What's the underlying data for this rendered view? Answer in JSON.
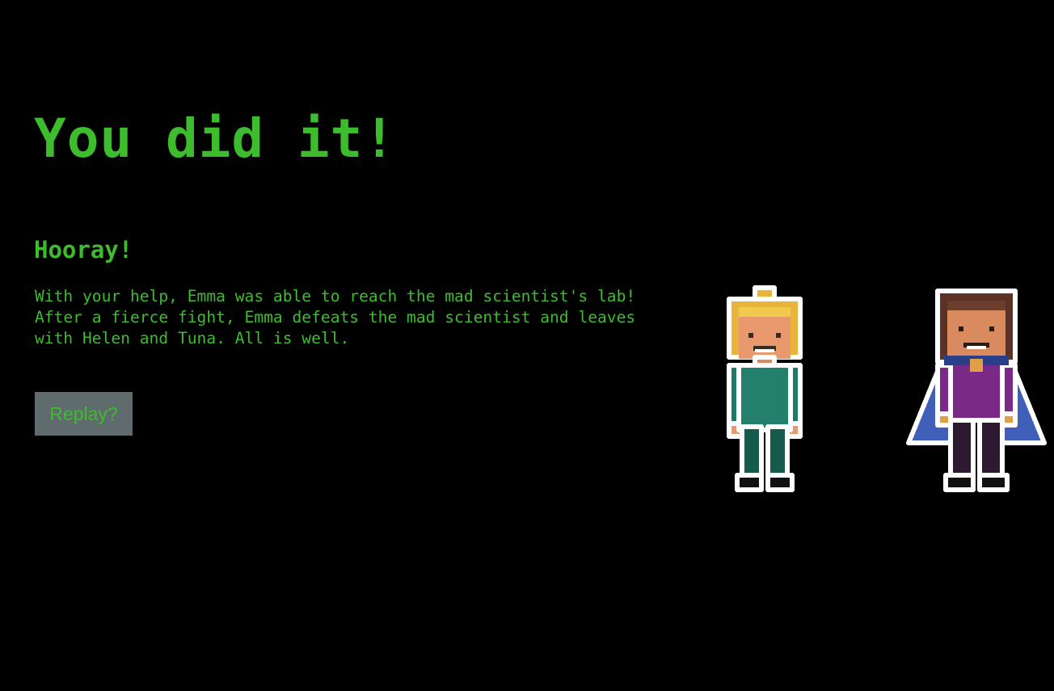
{
  "colors": {
    "background": "#000000",
    "text": "#3dbd2e",
    "button_bg": "#5f6b6c",
    "button_text": "#3dbd2e"
  },
  "title": "You did it!",
  "subtitle": "Hooray!",
  "story": {
    "line_1": "With your help, Emma was able to reach the mad scientist's lab!",
    "line_2": "After a fierce fight, Emma defeats the mad scientist and leaves",
    "line_3": "with Helen and Tuna. All is well."
  },
  "replay_button": {
    "label": "Replay?"
  },
  "characters": [
    {
      "icon": "blonde-girl-teal-outfit-sprite"
    },
    {
      "icon": "brown-haired-woman-blue-cape-sprite"
    }
  ]
}
